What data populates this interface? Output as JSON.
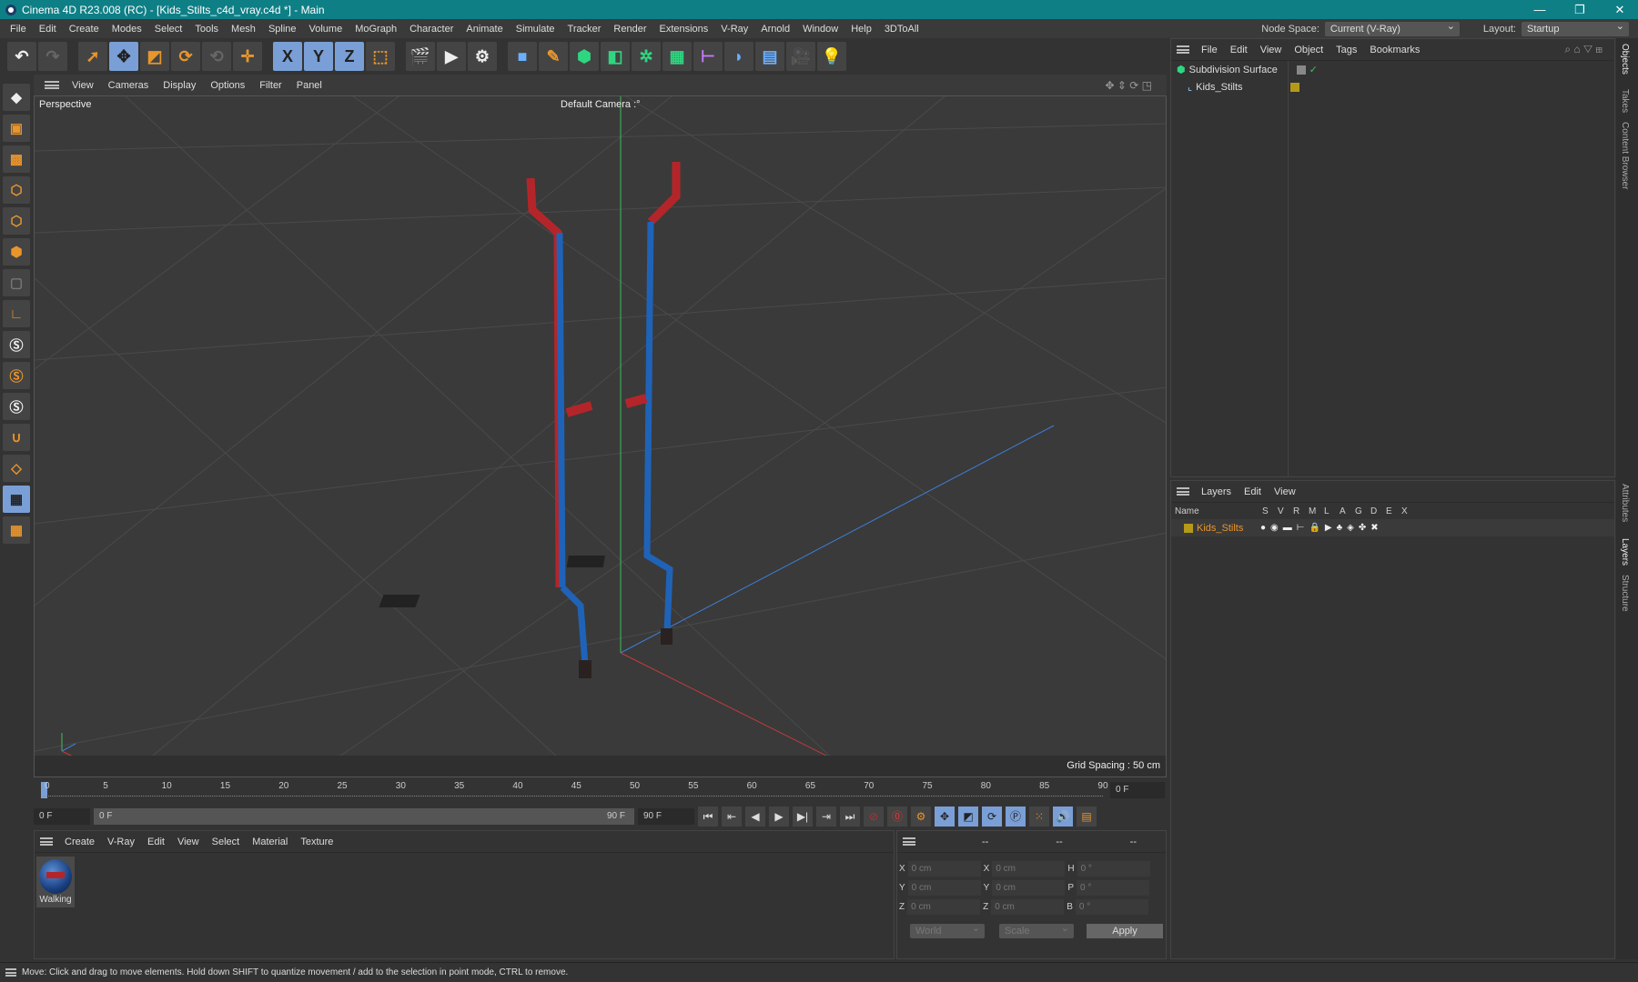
{
  "window": {
    "title": "Cinema 4D R23.008 (RC) - [Kids_Stilts_c4d_vray.c4d *] - Main",
    "minimize": "—",
    "restore": "❐",
    "close": "✕"
  },
  "menu": [
    "File",
    "Edit",
    "Create",
    "Modes",
    "Select",
    "Tools",
    "Mesh",
    "Spline",
    "Volume",
    "MoGraph",
    "Character",
    "Animate",
    "Simulate",
    "Tracker",
    "Render",
    "Extensions",
    "V-Ray",
    "Arnold",
    "Window",
    "Help",
    "3DToAll"
  ],
  "node_space": {
    "label": "Node Space:",
    "value": "Current (V-Ray)"
  },
  "layout": {
    "label": "Layout:",
    "value": "Startup"
  },
  "toolbar": {
    "x": "X",
    "y": "Y",
    "z": "Z"
  },
  "viewport": {
    "menu": [
      "View",
      "Cameras",
      "Display",
      "Options",
      "Filter",
      "Panel"
    ],
    "label": "Perspective",
    "camera": "Default Camera :°",
    "grid_spacing": "Grid Spacing : 50 cm"
  },
  "timeline": {
    "ticks": [
      "0",
      "5",
      "10",
      "15",
      "20",
      "25",
      "30",
      "35",
      "40",
      "45",
      "50",
      "55",
      "60",
      "65",
      "70",
      "75",
      "80",
      "85",
      "90"
    ],
    "current": "0 F",
    "start": "0 F",
    "range_start": "0 F",
    "range_end": "90 F",
    "end": "90 F"
  },
  "materials": {
    "menu": [
      "Create",
      "V-Ray",
      "Edit",
      "View",
      "Select",
      "Material",
      "Texture"
    ],
    "items": [
      {
        "name": "Walking"
      }
    ]
  },
  "coords": {
    "headers": [
      "--",
      "--",
      "--"
    ],
    "rows": [
      {
        "a": "X",
        "av": "0 cm",
        "b": "X",
        "bv": "0 cm",
        "c": "H",
        "cv": "0 °"
      },
      {
        "a": "Y",
        "av": "0 cm",
        "b": "Y",
        "bv": "0 cm",
        "c": "P",
        "cv": "0 °"
      },
      {
        "a": "Z",
        "av": "0 cm",
        "b": "Z",
        "bv": "0 cm",
        "c": "B",
        "cv": "0 °"
      }
    ],
    "world": "World",
    "scale": "Scale",
    "apply": "Apply"
  },
  "objects": {
    "menu": [
      "File",
      "Edit",
      "View",
      "Object",
      "Tags",
      "Bookmarks"
    ],
    "items": [
      {
        "name": "Subdivision Surface"
      },
      {
        "name": "Kids_Stilts"
      }
    ]
  },
  "layers": {
    "menu": [
      "Layers",
      "Edit",
      "View"
    ],
    "name_col": "Name",
    "cols": [
      "S",
      "V",
      "R",
      "M",
      "L",
      "A",
      "G",
      "D",
      "E",
      "X"
    ],
    "items": [
      {
        "name": "Kids_Stilts",
        "color": "#b59a1a"
      }
    ]
  },
  "right_tabs": [
    "Objects",
    "Takes",
    "Content Browser",
    "Attributes",
    "Layers",
    "Structure"
  ],
  "status": "Move: Click and drag to move elements. Hold down SHIFT to quantize movement / add to the selection in point mode, CTRL to remove.",
  "colors": {
    "accent": "#0f7f86",
    "selected": "#7a9fd6",
    "orange": "#e8952c",
    "layer_text": "#e8952c"
  }
}
